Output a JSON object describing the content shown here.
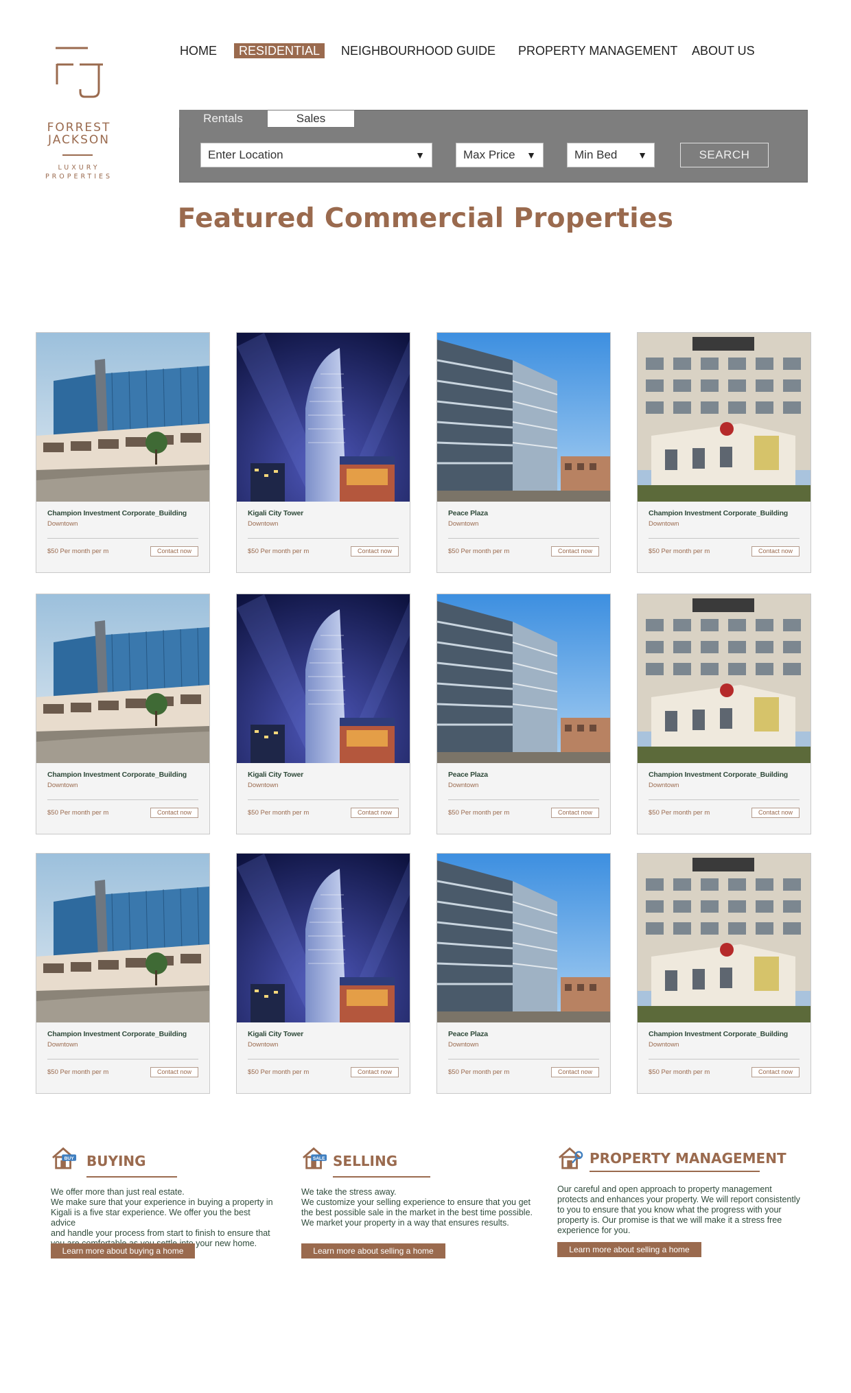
{
  "brand": {
    "name_line1": "FORREST",
    "name_line2": "JACKSON",
    "tagline_line1": "LUXURY",
    "tagline_line2": "PROPERTIES",
    "color": "#9a6a4e"
  },
  "nav": {
    "items": [
      {
        "label": "HOME",
        "active": false
      },
      {
        "label": "RESIDENTIAL",
        "active": true
      },
      {
        "label": "NEIGHBOURHOOD GUIDE",
        "active": false
      },
      {
        "label": "PROPERTY MANAGEMENT",
        "active": false
      },
      {
        "label": "ABOUT US",
        "active": false
      }
    ]
  },
  "search": {
    "tabs": {
      "rentals": "Rentals",
      "sales": "Sales",
      "selected": "Sales"
    },
    "location": "Enter Location",
    "max_price": "Max Price",
    "min_bed": "Min Bed",
    "button": "SEARCH",
    "caret": "▼"
  },
  "heading": "Featured Commercial Properties",
  "cards": [
    {
      "title": "Champion Investment Corporate_Building",
      "location": "Downtown",
      "price": "$50 Per month per m",
      "cta": "Contact now",
      "photo": "glass-office-blue-sky"
    },
    {
      "title": "Kigali City Tower",
      "location": "Downtown",
      "price": "$50 Per month per m",
      "cta": "Contact now",
      "photo": "tower-night"
    },
    {
      "title": "Peace Plaza",
      "location": "Downtown",
      "price": "$50 Per month per m",
      "cta": "Contact now",
      "photo": "plaza-blue-sky"
    },
    {
      "title": "Champion Investment Corporate_Building",
      "location": "Downtown",
      "price": "$50 Per month per m",
      "cta": "Contact now",
      "photo": "beige-building"
    },
    {
      "title": "Champion Investment Corporate_Building",
      "location": "Downtown",
      "price": "$50 Per month per m",
      "cta": "Contact now",
      "photo": "glass-office-blue-sky"
    },
    {
      "title": "Kigali City Tower",
      "location": "Downtown",
      "price": "$50 Per month per m",
      "cta": "Contact now",
      "photo": "tower-night"
    },
    {
      "title": "Peace Plaza",
      "location": "Downtown",
      "price": "$50 Per month per m",
      "cta": "Contact now",
      "photo": "plaza-blue-sky"
    },
    {
      "title": "Champion Investment Corporate_Building",
      "location": "Downtown",
      "price": "$50 Per month per m",
      "cta": "Contact now",
      "photo": "beige-building"
    },
    {
      "title": "Champion Investment Corporate_Building",
      "location": "Downtown",
      "price": "$50 Per month per m",
      "cta": "Contact now",
      "photo": "glass-office-blue-sky"
    },
    {
      "title": "Kigali City Tower",
      "location": "Downtown",
      "price": "$50 Per month per m",
      "cta": "Contact now",
      "photo": "tower-night"
    },
    {
      "title": "Peace Plaza",
      "location": "Downtown",
      "price": "$50 Per month per m",
      "cta": "Contact now",
      "photo": "plaza-blue-sky"
    },
    {
      "title": "Champion Investment Corporate_Building",
      "location": "Downtown",
      "price": "$50 Per month per m",
      "cta": "Contact now",
      "photo": "beige-building"
    }
  ],
  "info": {
    "buying": {
      "icon_badge": "BUY",
      "title": "BUYING",
      "lines": [
        "We offer more than just real estate.",
        "We make sure that your experience in buying a property in",
        "Kigali is a five star experience. We offer you the best advice",
        "and handle your process from start to finish to ensure that",
        "you are comfortable as you settle into your new home."
      ],
      "button": "Learn more about buying a home"
    },
    "selling": {
      "icon_badge": "SALE",
      "title": "SELLING",
      "lines": [
        "We take the stress away.",
        "We customize your selling experience to ensure that you get",
        "the best possible sale in the market in the best time possible.",
        "We market your property in a way that ensures results."
      ],
      "button": "Learn more about selling a home"
    },
    "management": {
      "title": "PROPERTY MANAGEMENT",
      "lines": [
        "Our careful and open approach to property management",
        "protects and enhances your property. We will report consistently",
        "to you to ensure that you know what the progress with your",
        "property is. Our promise is that we will make it a stress free",
        "experience for you."
      ],
      "button": "Learn more about selling a home"
    }
  }
}
